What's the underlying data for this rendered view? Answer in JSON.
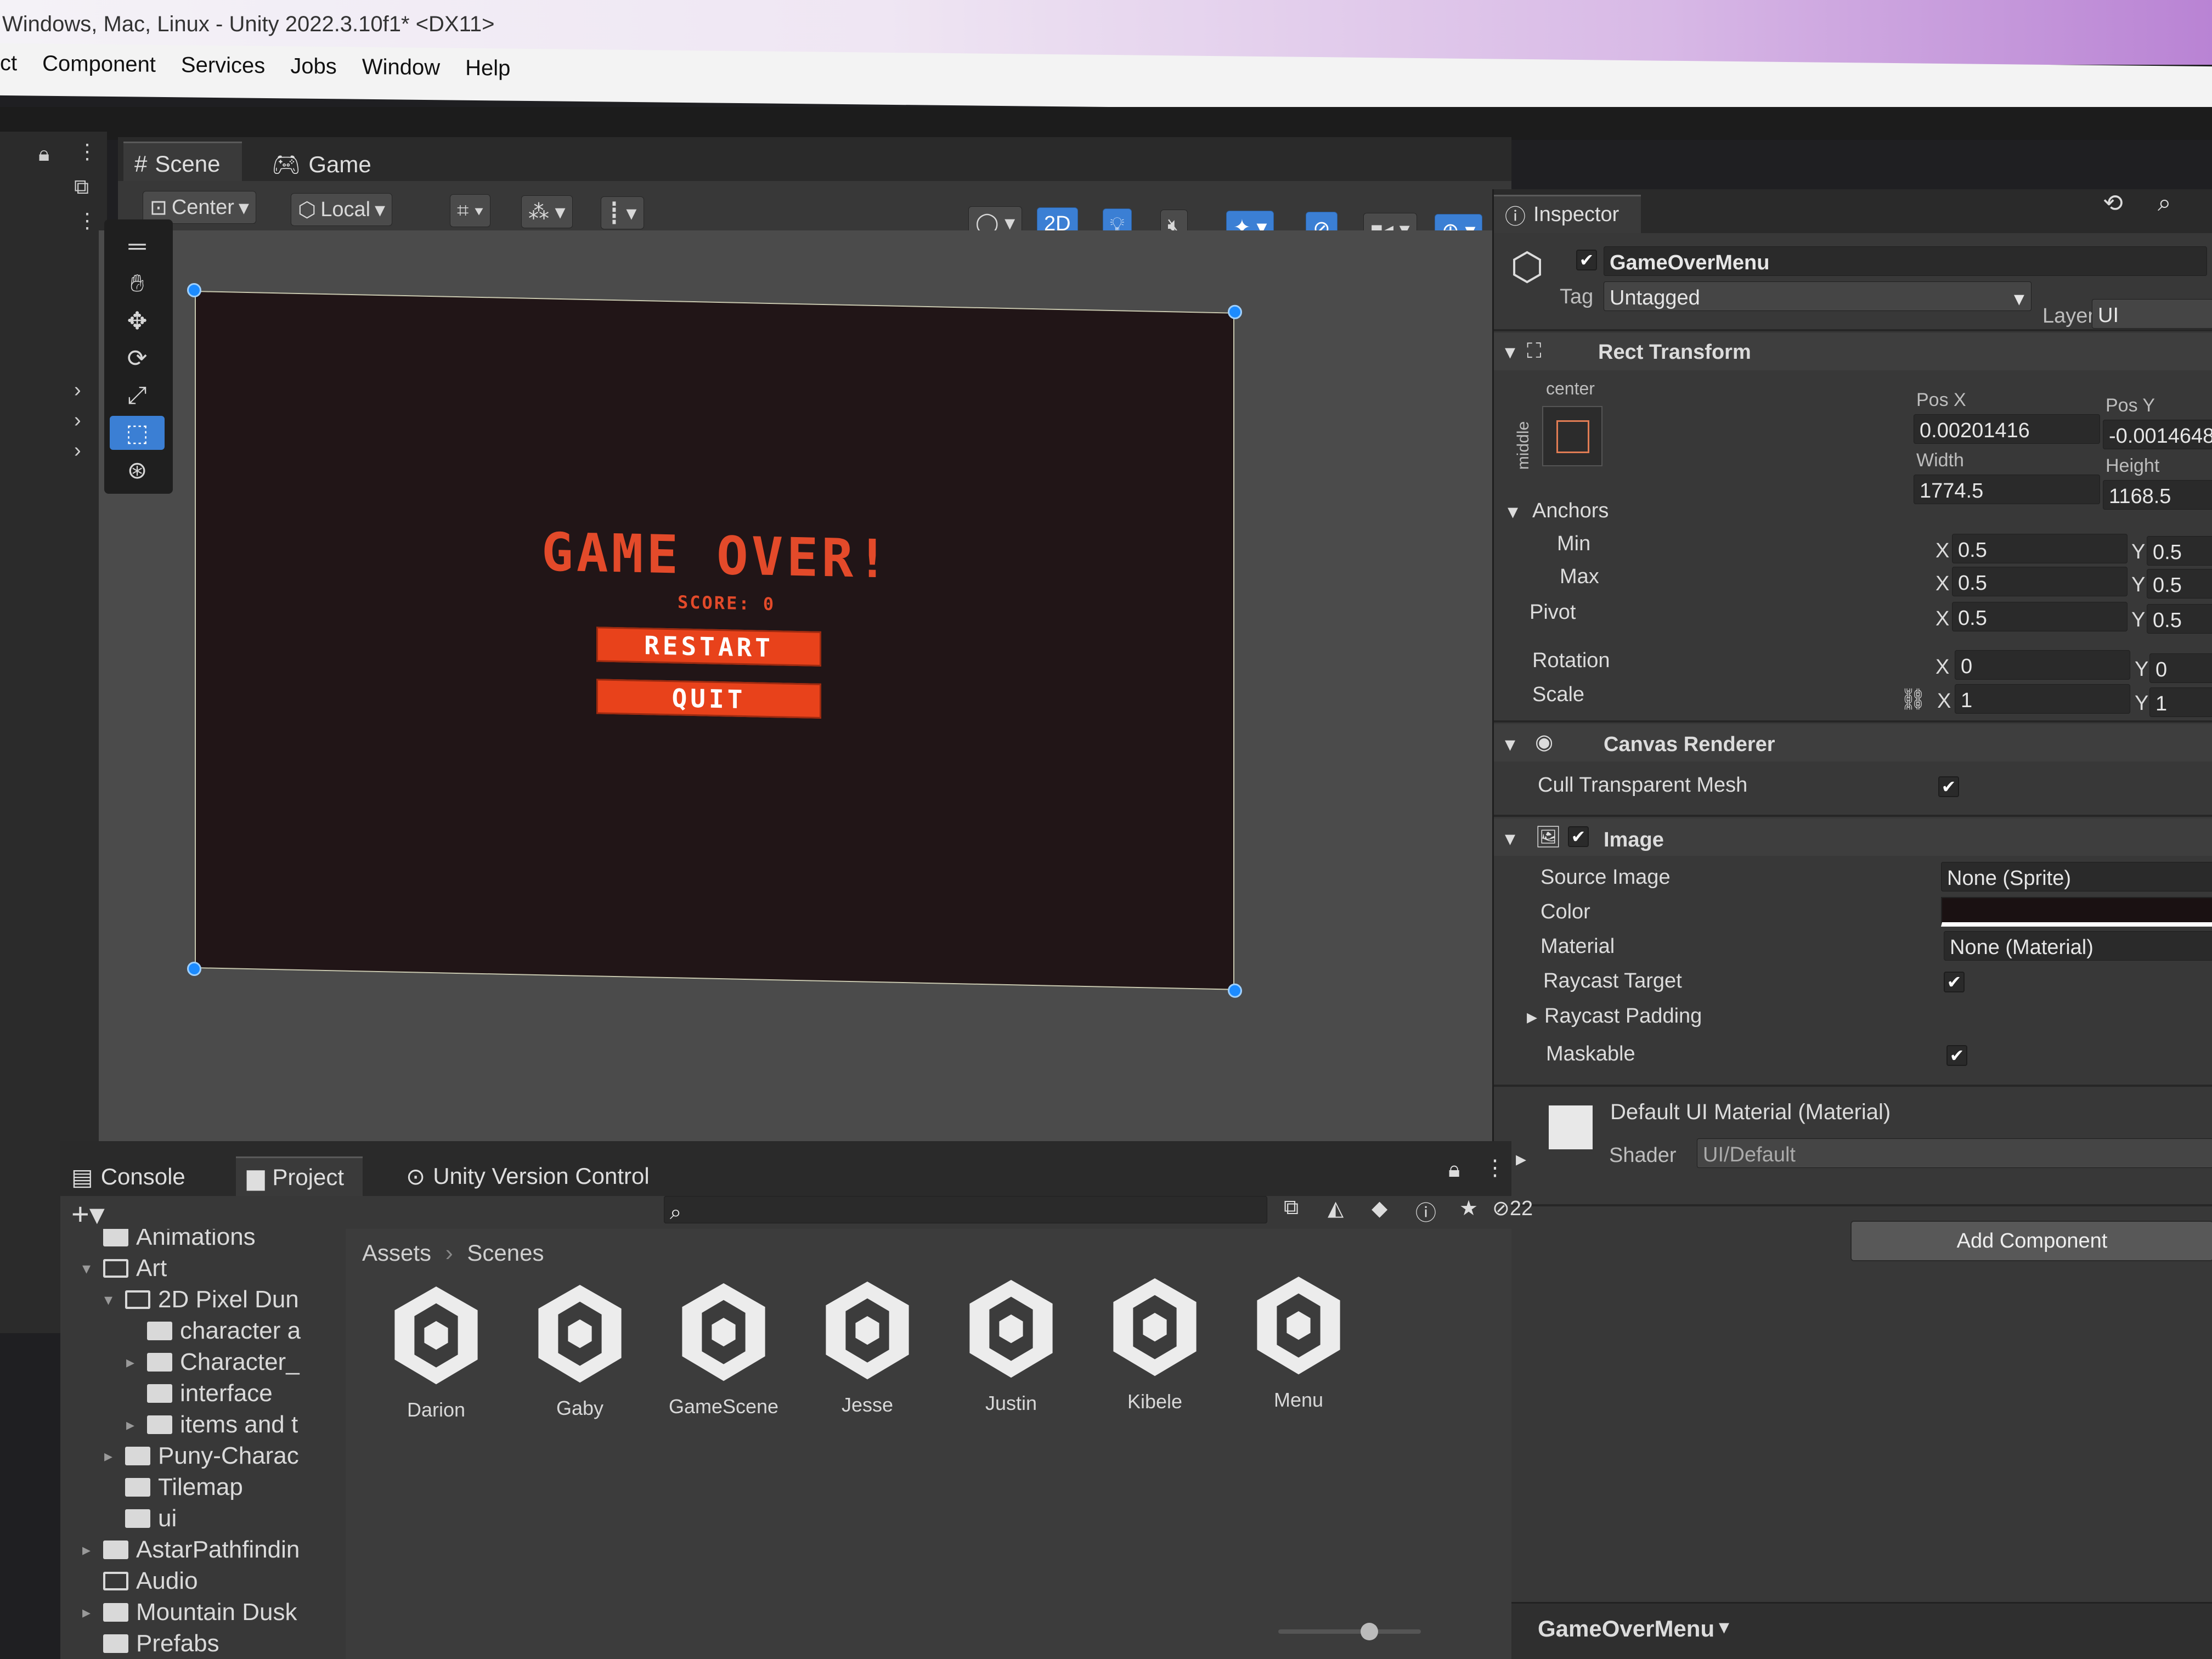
{
  "window": {
    "title": "Windows, Mac, Linux - Unity 2022.3.10f1* <DX11>"
  },
  "menu": [
    "ct",
    "Component",
    "Services",
    "Jobs",
    "Window",
    "Help"
  ],
  "scene_tabs": {
    "scene": "Scene",
    "game": "Game"
  },
  "scene_toolbar": {
    "pivot": "Center",
    "space": "Local",
    "mode2d": "2D"
  },
  "game": {
    "title": "GAME OVER!",
    "score": "SCORE: 0",
    "restart": "RESTART",
    "quit": "QUIT",
    "background": "#211517",
    "accent": "#e8421b"
  },
  "inspector": {
    "tab": "Inspector",
    "object_name": "GameOverMenu",
    "tag_label": "Tag",
    "tag_value": "Untagged",
    "layer_label": "Layer",
    "layer_value": "UI",
    "rect_transform": {
      "title": "Rect Transform",
      "anchor_h": "center",
      "anchor_v": "middle",
      "pos_x_label": "Pos X",
      "pos_x": "0.00201416",
      "pos_y_label": "Pos Y",
      "pos_y": "-0.0014648",
      "width_label": "Width",
      "width": "1774.5",
      "height_label": "Height",
      "height": "1168.5",
      "anchors_label": "Anchors",
      "min_label": "Min",
      "min_x": "0.5",
      "min_y": "0.5",
      "max_label": "Max",
      "max_x": "0.5",
      "max_y": "0.5",
      "pivot_label": "Pivot",
      "pivot_x": "0.5",
      "pivot_y": "0.5",
      "rotation_label": "Rotation",
      "rotation_x": "0",
      "rotation_y": "0",
      "scale_label": "Scale",
      "scale_x": "1",
      "scale_y": "1",
      "x": "X",
      "y": "Y"
    },
    "canvas_renderer": {
      "title": "Canvas Renderer",
      "cull_label": "Cull Transparent Mesh"
    },
    "image": {
      "title": "Image",
      "source_label": "Source Image",
      "source_value": "None (Sprite)",
      "color_label": "Color",
      "color_value": "#1a1112",
      "material_label": "Material",
      "material_value": "None (Material)",
      "raycast_target_label": "Raycast Target",
      "raycast_padding_label": "Raycast Padding",
      "maskable_label": "Maskable"
    },
    "material_block": {
      "title": "Default UI Material (Material)",
      "shader_label": "Shader",
      "shader_value": "UI/Default"
    },
    "add_component": "Add Component",
    "footer_name": "GameOverMenu"
  },
  "bottom_tabs": {
    "console": "Console",
    "project": "Project",
    "uvc": "Unity Version Control",
    "hidden_count": "22"
  },
  "tree": [
    {
      "label": "Animations",
      "indent": 0
    },
    {
      "label": "Art",
      "indent": 0
    },
    {
      "label": "2D Pixel Dun",
      "indent": 1
    },
    {
      "label": "character a",
      "indent": 2
    },
    {
      "label": "Character_",
      "indent": 2
    },
    {
      "label": "interface",
      "indent": 2
    },
    {
      "label": "items and t",
      "indent": 2
    },
    {
      "label": "Puny-Charac",
      "indent": 1
    },
    {
      "label": "Tilemap",
      "indent": 1
    },
    {
      "label": "ui",
      "indent": 1
    },
    {
      "label": "AstarPathfindin",
      "indent": 0
    },
    {
      "label": "Audio",
      "indent": 0
    },
    {
      "label": "Mountain Dusk",
      "indent": 0
    },
    {
      "label": "Prefabs",
      "indent": 0
    }
  ],
  "breadcrumb": {
    "root": "Assets",
    "current": "Scenes"
  },
  "scenes": [
    "Darion",
    "Gaby",
    "GameScene",
    "Jesse",
    "Justin",
    "Kibele",
    "Menu"
  ]
}
